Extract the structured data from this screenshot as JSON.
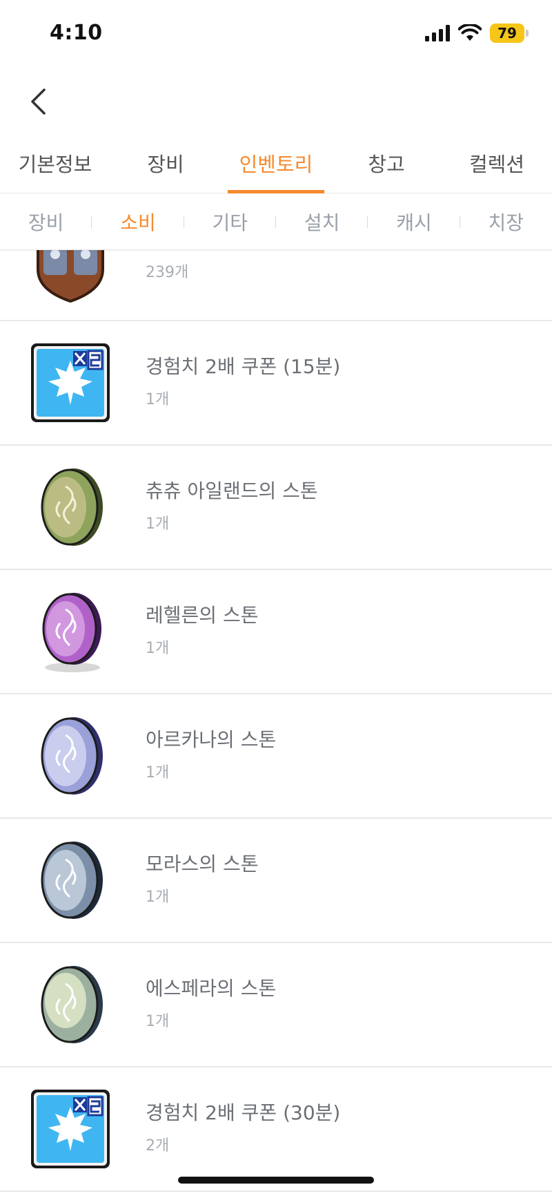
{
  "status": {
    "time": "4:10",
    "battery": "79"
  },
  "nav": {
    "back_icon": "chevron-left-icon"
  },
  "main_tabs": [
    {
      "label": "기본정보"
    },
    {
      "label": "장비"
    },
    {
      "label": "인벤토리"
    },
    {
      "label": "창고"
    },
    {
      "label": "컬렉션"
    }
  ],
  "main_tab_active": "인벤토리",
  "sub_tabs": [
    {
      "label": "장비"
    },
    {
      "label": "소비"
    },
    {
      "label": "기타"
    },
    {
      "label": "설치"
    },
    {
      "label": "캐시"
    },
    {
      "label": "치장"
    }
  ],
  "sub_tab_active": "소비",
  "colors": {
    "accent": "#f58a2f",
    "text": "#6b6f75",
    "subtext": "#a8adb3"
  },
  "items": [
    {
      "name": "",
      "count": "239개",
      "icon": "shield-item-icon"
    },
    {
      "name": "경험치 2배 쿠폰 (15분)",
      "count": "1개",
      "icon": "exp-coupon-icon"
    },
    {
      "name": "츄츄 아일랜드의 스톤",
      "count": "1개",
      "icon": "green-stone-icon"
    },
    {
      "name": "레헬른의 스톤",
      "count": "1개",
      "icon": "purple-stone-icon"
    },
    {
      "name": "아르카나의 스톤",
      "count": "1개",
      "icon": "lavender-stone-icon"
    },
    {
      "name": "모라스의 스톤",
      "count": "1개",
      "icon": "steel-stone-icon"
    },
    {
      "name": "에스페라의 스톤",
      "count": "1개",
      "icon": "pale-stone-icon"
    },
    {
      "name": "경험치 2배 쿠폰 (30분)",
      "count": "2개",
      "icon": "exp-coupon-icon"
    }
  ]
}
